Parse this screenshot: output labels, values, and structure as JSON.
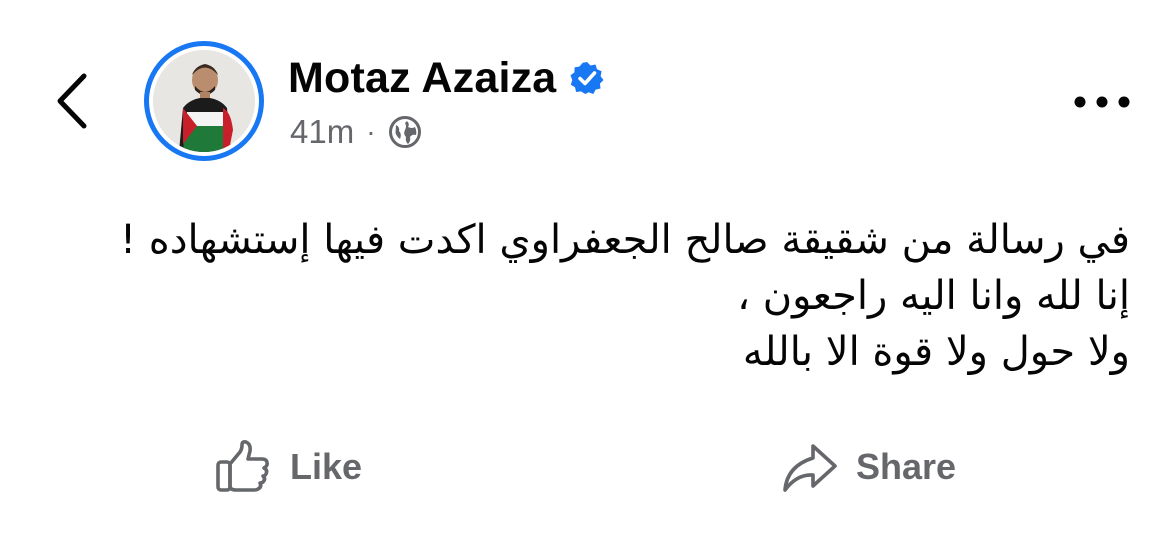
{
  "header": {
    "back_icon": "chevron-left-icon",
    "author_name": "Motaz Azaiza",
    "verified_icon": "verified-badge-icon",
    "verified_color": "#1877f2",
    "time_ago": "41m",
    "separator": "·",
    "audience_icon": "globe-icon",
    "more_icon": "more-horizontal-icon"
  },
  "post": {
    "lines": [
      "في رسالة من شقيقة صالح الجعفراوي اكدت فيها إستشهاده !",
      "إنا لله وانا اليه راجعون ،",
      "ولا حول ولا قوة الا بالله"
    ]
  },
  "actions": {
    "like_label": "Like",
    "like_icon": "thumbs-up-icon",
    "share_label": "Share",
    "share_icon": "share-arrow-icon"
  },
  "colors": {
    "text_primary": "#050505",
    "text_secondary": "#65676b",
    "accent": "#1877f2"
  }
}
